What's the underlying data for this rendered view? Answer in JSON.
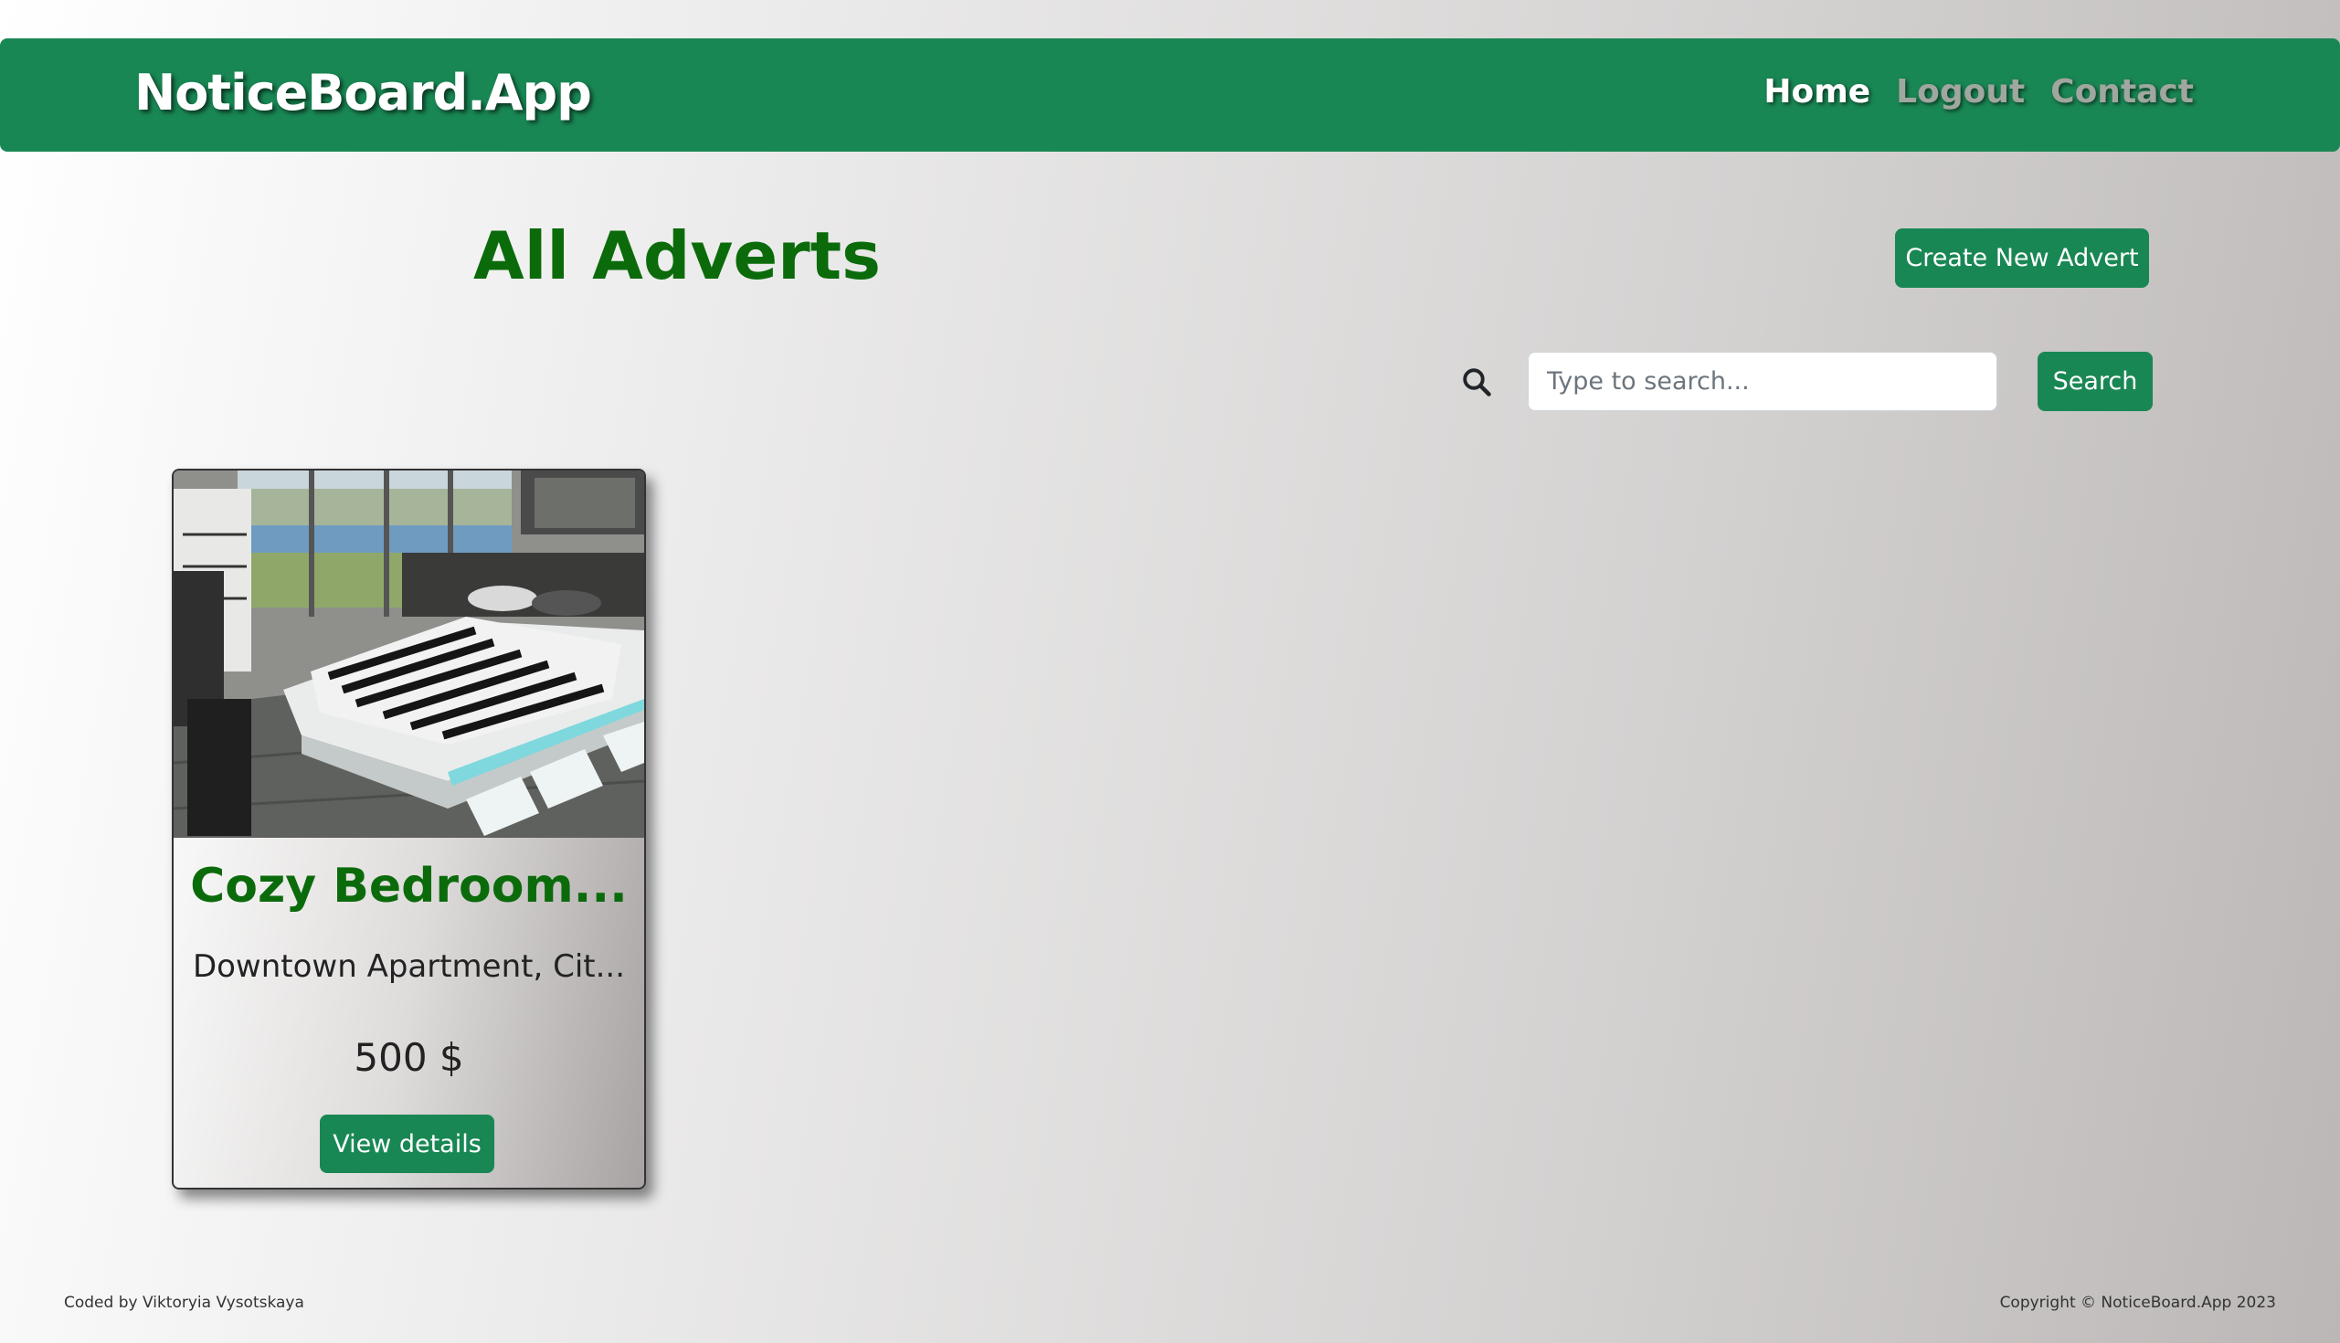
{
  "navbar": {
    "brand": "NoticeBoard.App",
    "links": [
      {
        "label": "Home",
        "active": true
      },
      {
        "label": "Logout",
        "active": false
      },
      {
        "label": "Contact",
        "active": false
      }
    ]
  },
  "main": {
    "title": "All Adverts",
    "create_button": "Create New Advert",
    "search": {
      "icon": "search-icon",
      "placeholder": "Type to search...",
      "value": "",
      "button": "Search"
    },
    "adverts": [
      {
        "title": "Cozy Bedroom...",
        "location": "Downtown Apartment, Cit...",
        "price": "500 $",
        "button": "View details"
      }
    ]
  },
  "footer": {
    "left": "Coded by Viktoryia Vysotskaya",
    "right": "Copyright © NoticeBoard.App 2023"
  },
  "colors": {
    "primary": "#198754",
    "heading": "#0b6b0b"
  }
}
